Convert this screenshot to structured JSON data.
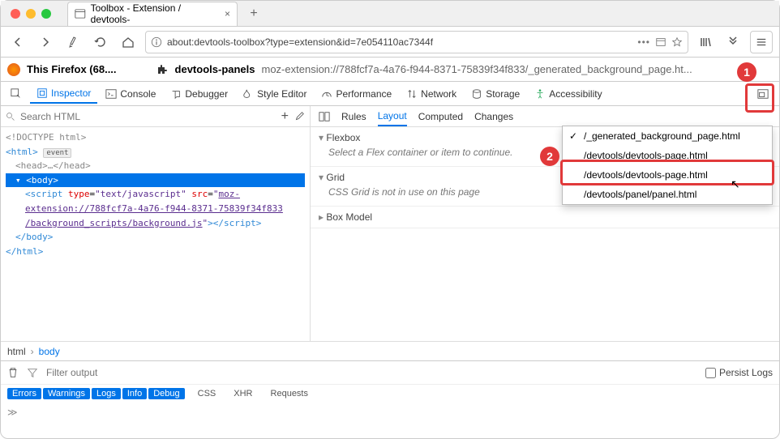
{
  "titlebar": {
    "tab_title": "Toolbox - Extension / devtools-"
  },
  "navbar": {
    "url": "about:devtools-toolbox?type=extension&id=7e054110ac7344f"
  },
  "context": {
    "firefox_label": "This Firefox (68....",
    "ext_name": "devtools-panels",
    "ext_url": "moz-extension://788fcf7a-4a76-f944-8371-75839f34f833/_generated_background_page.ht..."
  },
  "tools": {
    "inspector": "Inspector",
    "console": "Console",
    "debugger": "Debugger",
    "style": "Style Editor",
    "performance": "Performance",
    "network": "Network",
    "storage": "Storage",
    "accessibility": "Accessibility"
  },
  "search_placeholder": "Search HTML",
  "tree": {
    "doctype": "<!DOCTYPE html>",
    "html_open": "<html>",
    "event": "event",
    "head": "<head>…</head>",
    "body_open": "<body>",
    "script_ln1": "<script type=\"text/javascript\" src=\"moz-",
    "script_ln2": "extension://788fcf7a-4a76-f944-8371-75839f34f833",
    "script_ln3": "/background_scripts/background.js\"></scr",
    "script_close": "ipt>",
    "body_close": "</body>",
    "html_close": "</html>"
  },
  "right_tabs": {
    "rules": "Rules",
    "layout": "Layout",
    "computed": "Computed",
    "changes": "Changes"
  },
  "layout": {
    "flexbox": "Flexbox",
    "flex_msg": "Select a Flex container or item to continue.",
    "grid": "Grid",
    "grid_msg": "CSS Grid is not in use on this page",
    "boxmodel": "Box Model"
  },
  "dropdown": {
    "item1": "/_generated_background_page.html",
    "item2": "/devtools/devtools-page.html",
    "item3": "/devtools/devtools-page.html",
    "item4": "/devtools/panel/panel.html"
  },
  "crumbs": {
    "root": "html",
    "cur": "body"
  },
  "console": {
    "filter_placeholder": "Filter output",
    "errors": "Errors",
    "warnings": "Warnings",
    "logs": "Logs",
    "info": "Info",
    "debug": "Debug",
    "css": "CSS",
    "xhr": "XHR",
    "requests": "Requests",
    "persist": "Persist Logs"
  },
  "badges": {
    "one": "1",
    "two": "2"
  }
}
